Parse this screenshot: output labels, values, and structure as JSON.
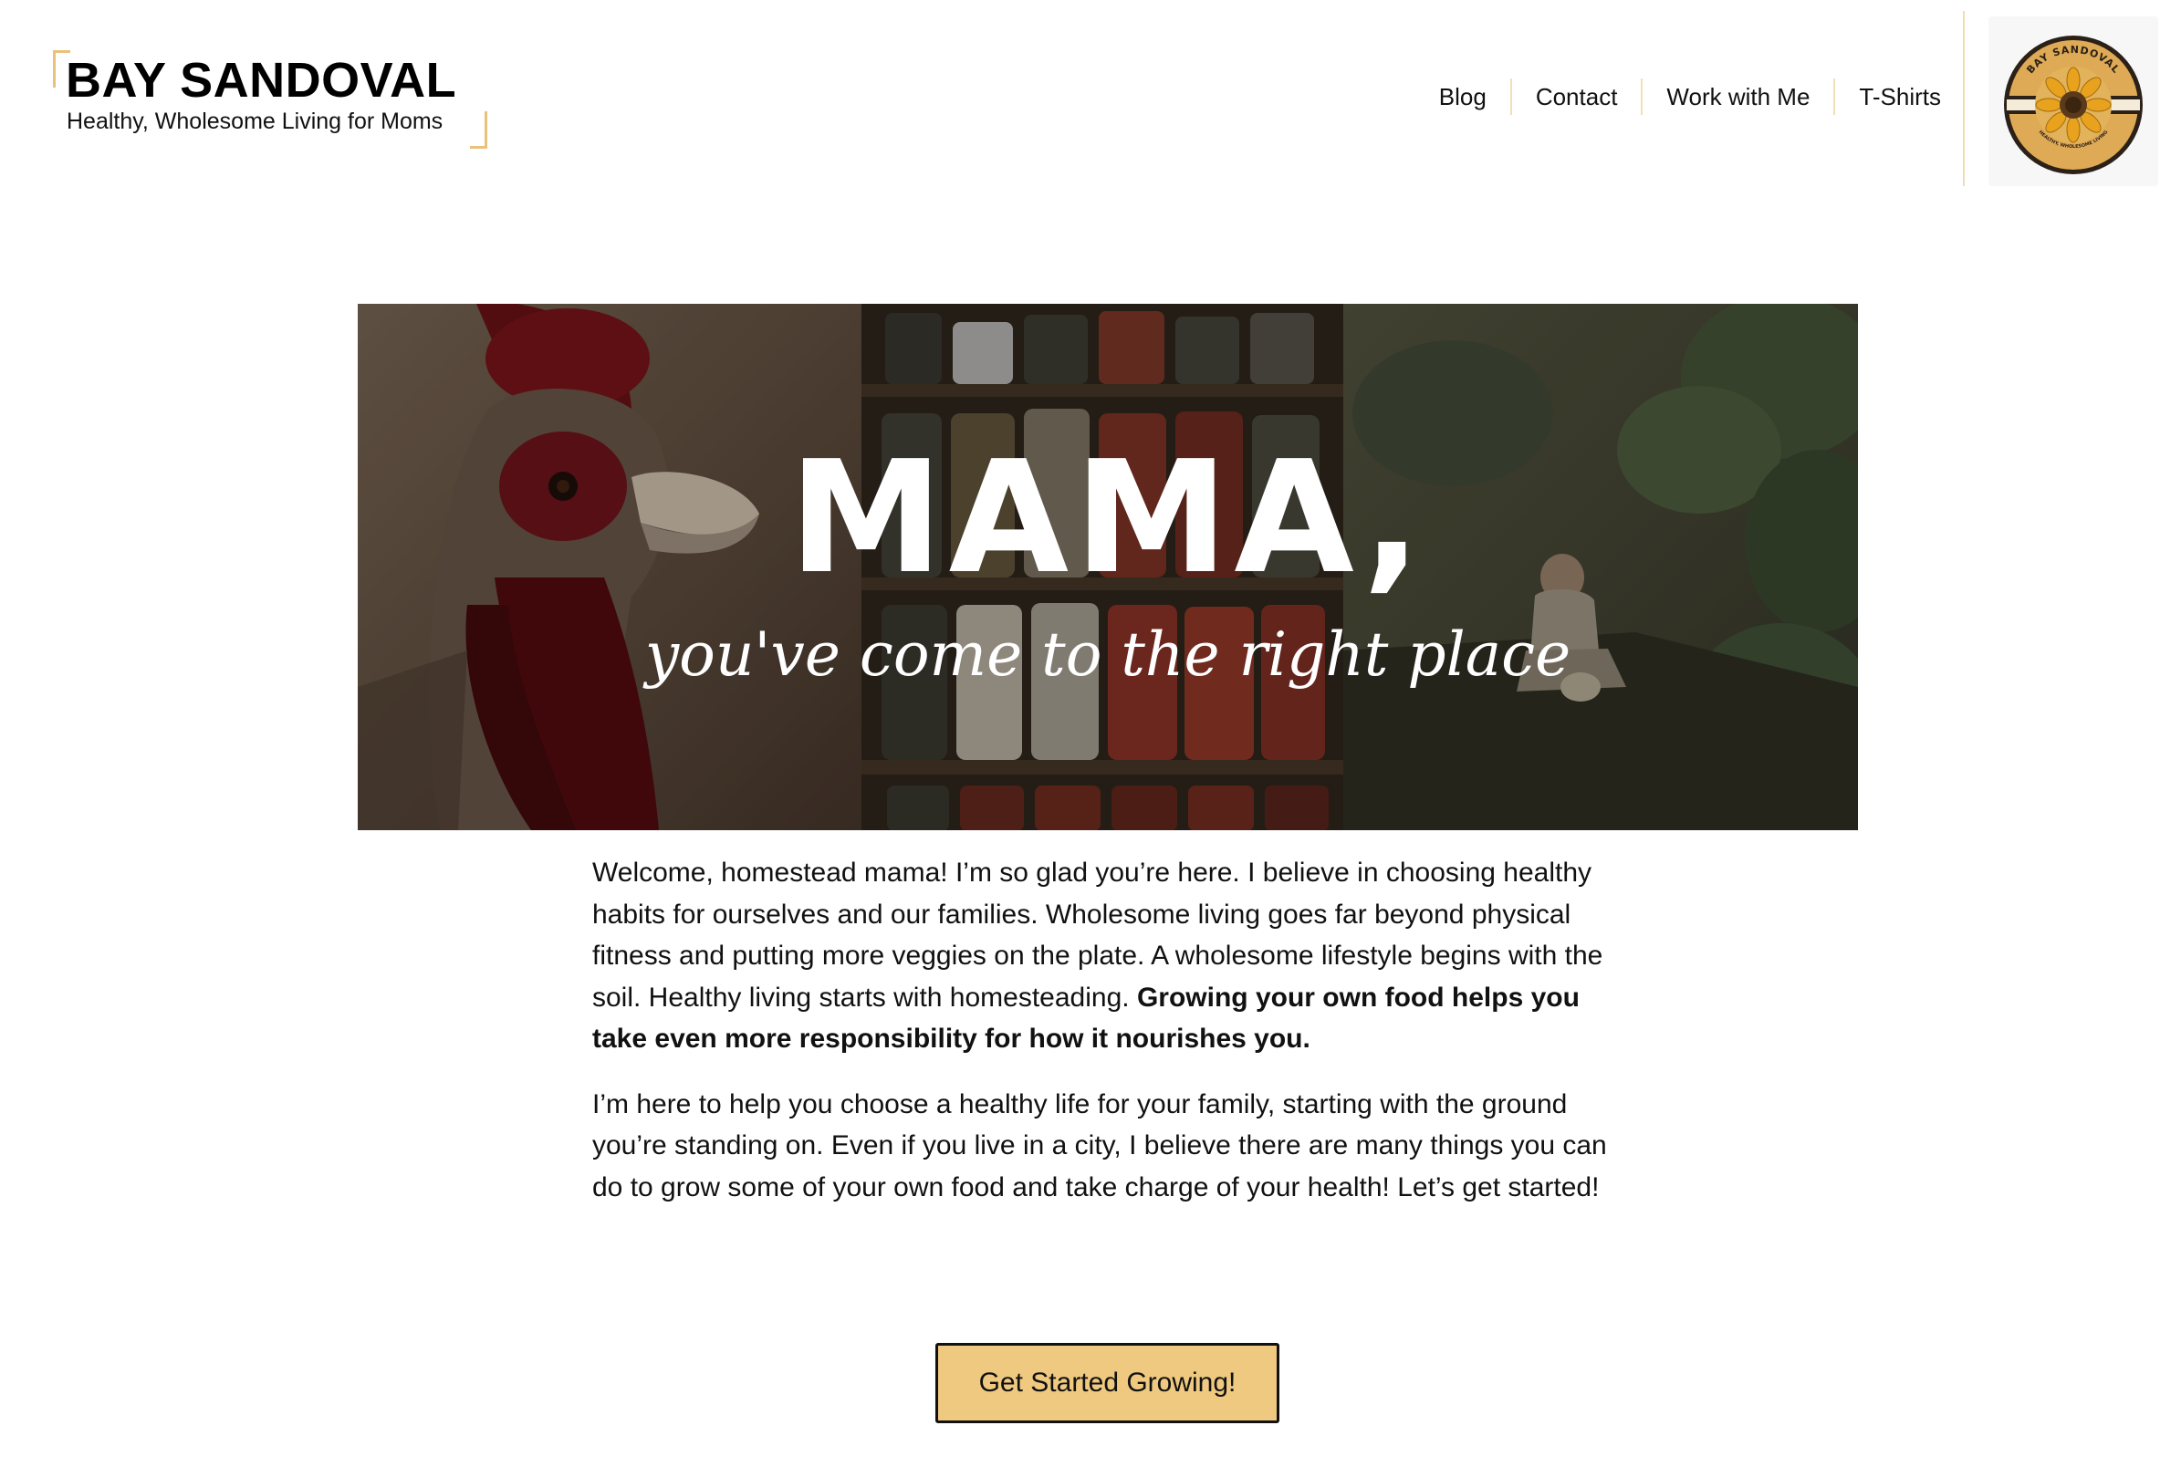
{
  "brand": {
    "title": "BAY SANDOVAL",
    "tagline": "Healthy, Wholesome Living for Moms",
    "accent": "#e8c27a"
  },
  "nav": {
    "items": [
      {
        "label": "Blog"
      },
      {
        "label": "Contact"
      },
      {
        "label": "Work with Me"
      },
      {
        "label": "T-Shirts"
      }
    ]
  },
  "logo": {
    "icon": "sunflower-badge-icon",
    "ring_text": "BAY SANDOVAL",
    "bottom_text": "HEALTHY, WHOLESOME LIVING"
  },
  "hero": {
    "title": "MAMA,",
    "subtitle": "you've come to the right place",
    "images": [
      "rooster",
      "pantry-jars",
      "child-in-garden"
    ]
  },
  "content": {
    "para1_text": "Welcome, homestead mama! I’m so glad you’re here. I believe in choosing healthy habits for ourselves and our families. Wholesome living goes far beyond physical fitness and putting more veggies on the plate. A wholesome lifestyle begins with the soil. Healthy living starts with homesteading. ",
    "para1_bold": "Growing your own food helps you take even more responsibility for how it nourishes you.",
    "para2": "I’m here to help you choose a healthy life for your family, starting with the ground you’re standing on. Even if you live in a city, I believe there are many things you can do to grow some of your own food and take charge of your health! Let’s get started!"
  },
  "cta": {
    "label": "Get Started Growing!",
    "color": "#efc97f"
  }
}
